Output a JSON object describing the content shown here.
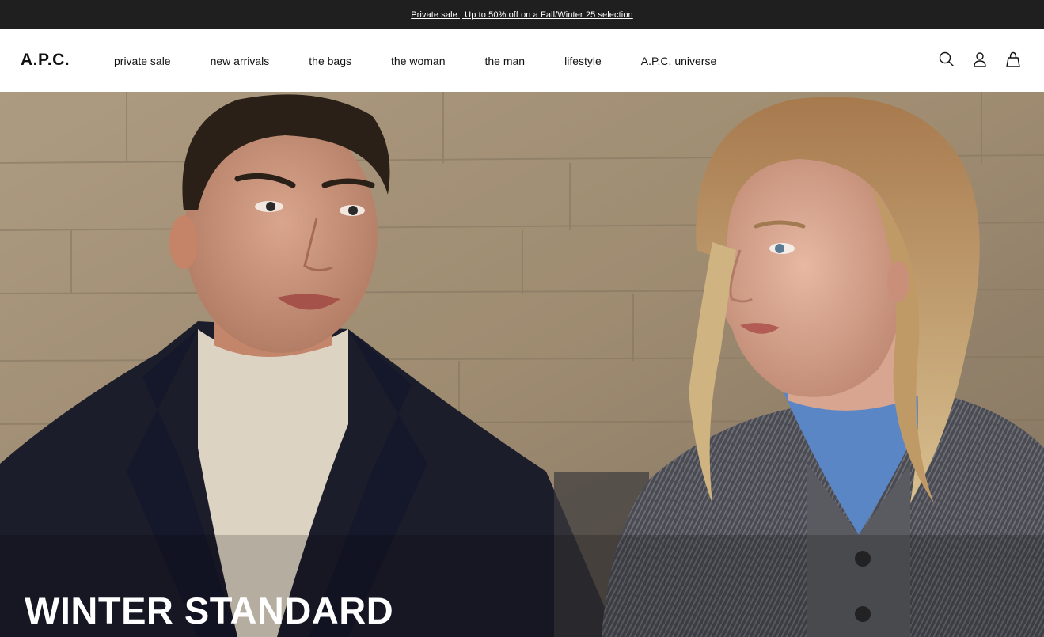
{
  "promo": {
    "text": "Private sale | Up to 50% off on a Fall/Winter 25 selection"
  },
  "header": {
    "logo": "A.P.C.",
    "nav": [
      {
        "label": "private sale"
      },
      {
        "label": "new arrivals"
      },
      {
        "label": "the bags"
      },
      {
        "label": "the woman"
      },
      {
        "label": "the man"
      },
      {
        "label": "lifestyle"
      },
      {
        "label": "A.P.C. universe"
      }
    ],
    "icons": [
      "search-icon",
      "account-icon",
      "bag-icon"
    ]
  },
  "hero": {
    "title": "WINTER STANDARD"
  },
  "colors": {
    "promo_bg": "#1f1f1f",
    "header_bg": "#ffffff",
    "text": "#111111",
    "hero_title": "#ffffff"
  }
}
